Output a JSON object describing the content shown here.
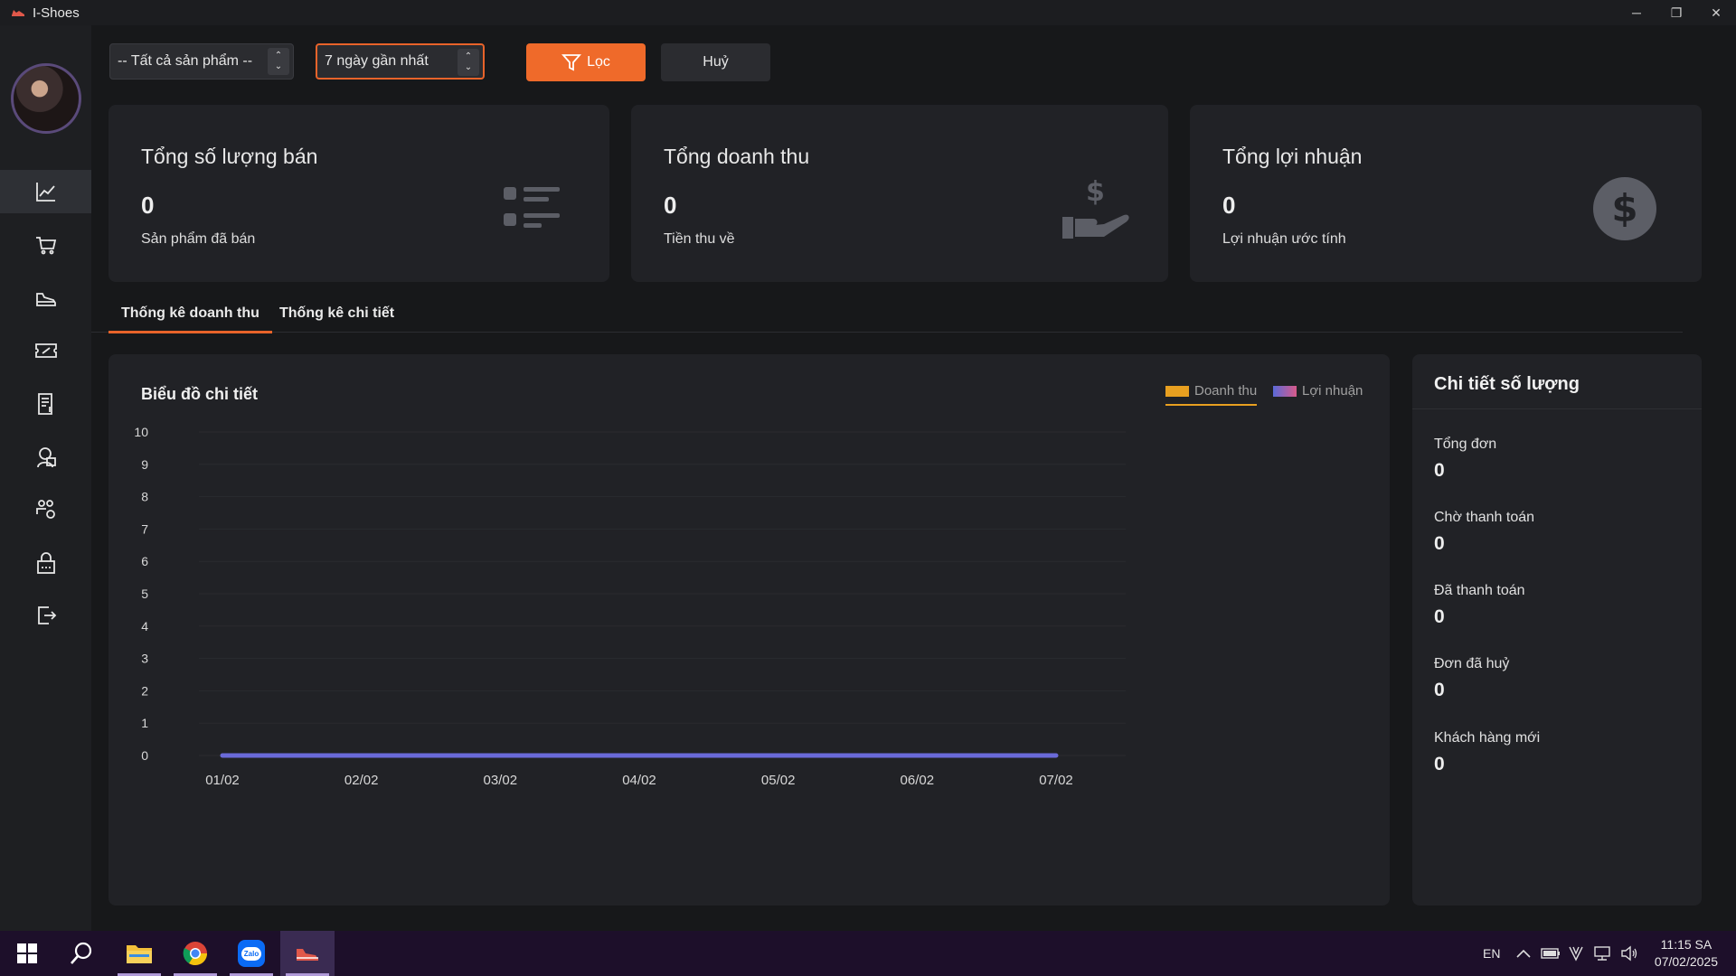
{
  "window": {
    "title": "I-Shoes",
    "minimize": "─",
    "restore": "❐",
    "close": "✕"
  },
  "sidebar": {
    "items": [
      {
        "name": "statistics",
        "active": true
      },
      {
        "name": "cart"
      },
      {
        "name": "shoe-product"
      },
      {
        "name": "voucher"
      },
      {
        "name": "invoice"
      },
      {
        "name": "customer"
      },
      {
        "name": "employees-settings"
      },
      {
        "name": "password-lock"
      },
      {
        "name": "logout"
      }
    ]
  },
  "filters": {
    "product_select": "-- Tất cả sản phẩm --",
    "period_select": "7 ngày gần nhất",
    "filter_button": "Lọc",
    "cancel_button": "Huỷ",
    "spin_up": "⌃",
    "spin_down": "⌄"
  },
  "cards": [
    {
      "title": "Tổng số lượng bán",
      "value": "0",
      "sub": "Sản phẩm đã bán"
    },
    {
      "title": "Tổng doanh thu",
      "value": "0",
      "sub": "Tiền thu về"
    },
    {
      "title": "Tổng lợi nhuận",
      "value": "0",
      "sub": "Lợi nhuận ước tính"
    }
  ],
  "tabs": [
    {
      "label": "Thống kê doanh thu",
      "active": true
    },
    {
      "label": "Thống kê chi tiết"
    }
  ],
  "chart_panel": {
    "title": "Biểu đồ chi tiết"
  },
  "chart_data": {
    "type": "line",
    "categories": [
      "01/02",
      "02/02",
      "03/02",
      "04/02",
      "05/02",
      "06/02",
      "07/02"
    ],
    "series": [
      {
        "name": "Doanh thu",
        "values": [
          0,
          0,
          0,
          0,
          0,
          0,
          0
        ],
        "color": "#e8a020"
      },
      {
        "name": "Lợi nhuận",
        "values": [
          0,
          0,
          0,
          0,
          0,
          0,
          0
        ],
        "color": "#6a6ad8"
      }
    ],
    "ylim": [
      0,
      10
    ],
    "yticks": [
      "0",
      "1",
      "2",
      "3",
      "4",
      "5",
      "6",
      "7",
      "8",
      "9",
      "10"
    ],
    "grid": true,
    "legend_position": "top-right"
  },
  "detail": {
    "title": "Chi tiết số lượng",
    "items": [
      {
        "label": "Tổng đơn",
        "value": "0"
      },
      {
        "label": "Chờ thanh toán",
        "value": "0"
      },
      {
        "label": "Đã thanh toán",
        "value": "0"
      },
      {
        "label": "Đơn đã huỷ",
        "value": "0"
      },
      {
        "label": "Khách hàng mới",
        "value": "0"
      }
    ]
  },
  "taskbar": {
    "language": "EN",
    "time": "11:15 SA",
    "date": "07/02/2025",
    "zalo_label": "Zalo"
  },
  "colors": {
    "accent": "#ef6a2a",
    "panel": "#212226",
    "background": "#17181a"
  }
}
